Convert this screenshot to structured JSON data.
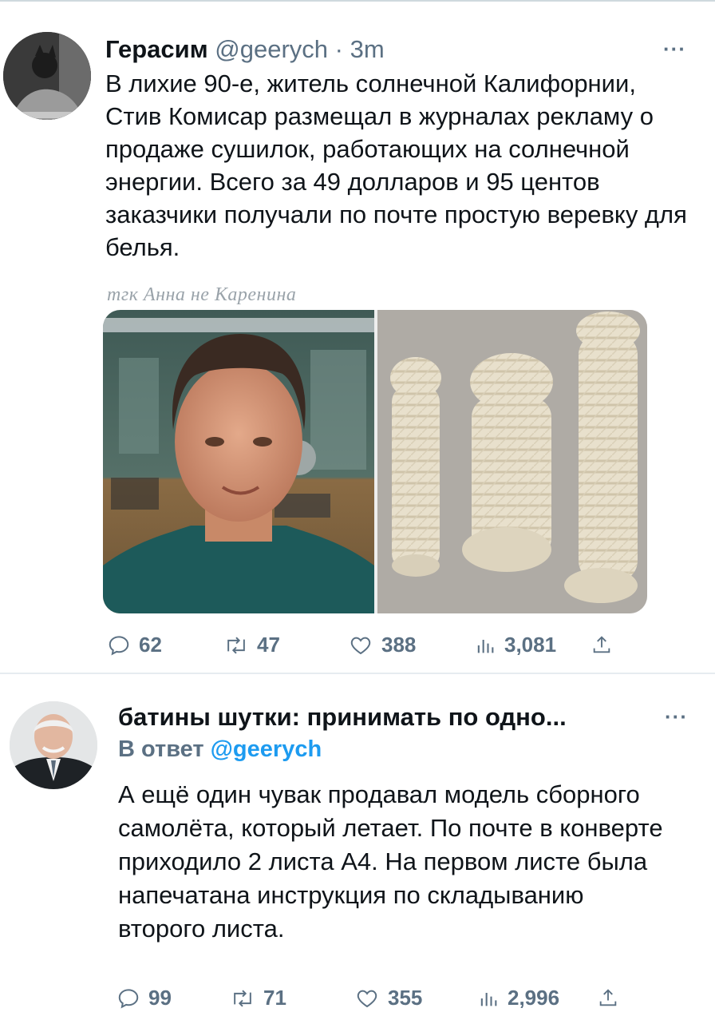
{
  "tweets": [
    {
      "author_name": "Герасим",
      "handle": "@geerych",
      "separator": "·",
      "time": "3m",
      "more": "···",
      "text": "В лихие 90-е, житель солнечной Калифорнии, Стив Комисар размещал в журналах рекламу о продаже сушилок, работающих на солнечной энергии. Всего за 49 долларов и 95 центов заказчики получали по почте простую веревку для белья.",
      "watermark": "тгк Анна не Каренина",
      "actions": {
        "replies": "62",
        "retweets": "47",
        "likes": "388",
        "views": "3,081"
      },
      "icons": [
        "reply-icon",
        "retweet-icon",
        "like-icon",
        "views-icon",
        "share-icon"
      ]
    },
    {
      "author_name": "батины шутки: принимать по одно...",
      "reply_prefix": "В ответ",
      "reply_mention": "@geerych",
      "more": "···",
      "text": "А ещё один чувак продавал модель сборного самолёта, который летает. По почте в конверте приходило 2 листа А4. На первом листе была напечатана инструкция по складыванию второго листа.",
      "actions": {
        "replies": "99",
        "retweets": "71",
        "likes": "355",
        "views": "2,996"
      },
      "icons": [
        "reply-icon",
        "retweet-icon",
        "like-icon",
        "views-icon",
        "share-icon"
      ]
    }
  ],
  "colors": {
    "text": "#0f1419",
    "muted": "#5b7083",
    "link": "#1d9bf0",
    "divider": "#e6ecf0"
  }
}
